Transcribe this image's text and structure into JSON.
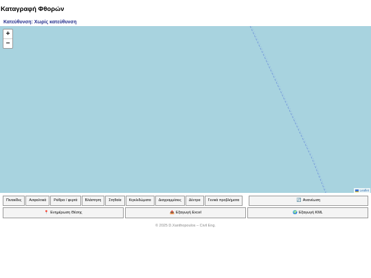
{
  "title": "Καταγραφή Φθορών",
  "direction_label": "Κατεύθυνση: Χωρίς κατεύθυνση",
  "map": {
    "zoom_in": "+",
    "zoom_out": "−",
    "attribution": "Leaflet",
    "background_color": "#a8d3df",
    "route_color": "#6a8fd8"
  },
  "categories": [
    "Πινακίδες",
    "Ασφαλτικά",
    "Ρείθρα / φερτά",
    "Βλάστηση",
    "Στηθαία",
    "Κιγκλιδώματα",
    "Διαγραμμίσεις",
    "Δέντρα",
    "Γενικά προβλήματα"
  ],
  "buttons": {
    "refresh": {
      "icon": "🔄",
      "label": "Ανανέωση"
    },
    "update_position": {
      "icon": "📍",
      "label": "Ενημέρωση Θέσης"
    },
    "export_excel": {
      "icon": "📤",
      "label": "Εξαγωγή Excel"
    },
    "export_kml": {
      "icon": "🌍",
      "label": "Εξαγωγή KML"
    }
  },
  "footer": "© 2025 D.Xanthopoulos – Civil Eng."
}
